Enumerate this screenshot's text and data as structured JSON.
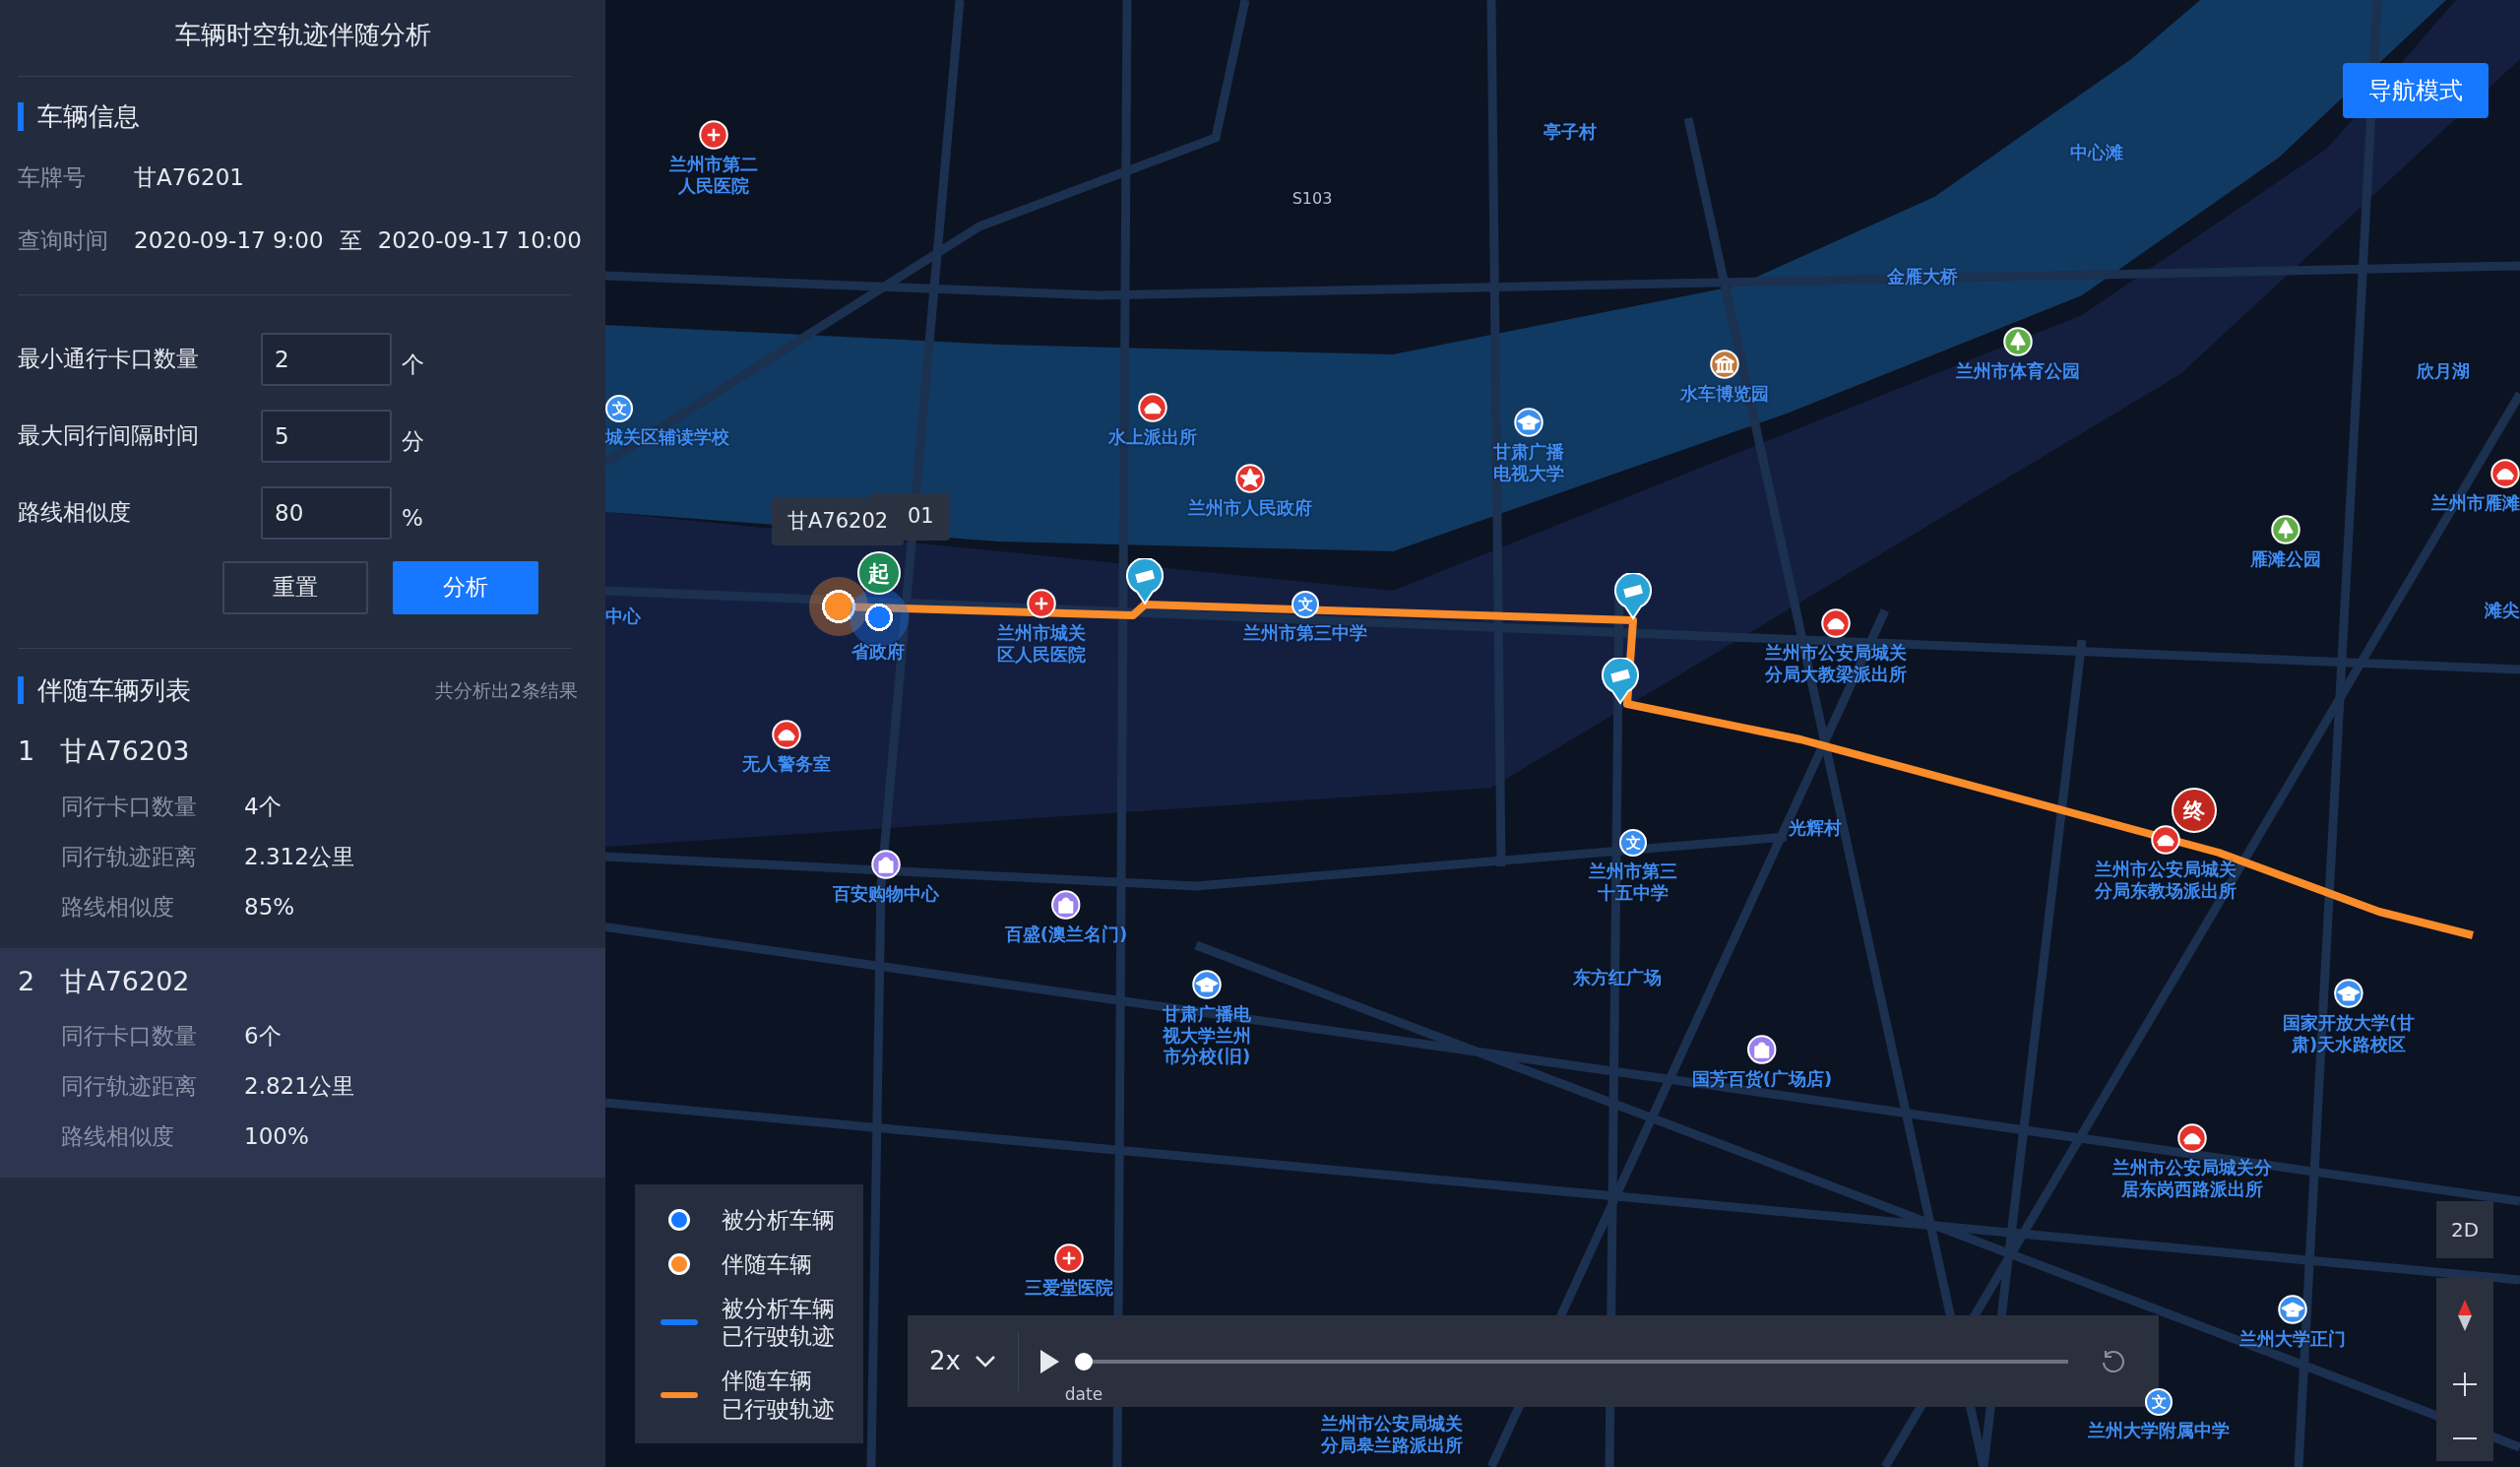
{
  "panel": {
    "title": "车辆时空轨迹伴随分析",
    "vehicle_info": {
      "heading": "车辆信息",
      "plate_label": "车牌号",
      "plate": "甘A76201",
      "time_label": "查询时间",
      "time_start": "2020-09-17 9:00",
      "time_sep": "至",
      "time_end": "2020-09-17 10:00"
    },
    "params": [
      {
        "label": "最小通行卡口数量",
        "value": "2",
        "unit": "个"
      },
      {
        "label": "最大同行间隔时间",
        "value": "5",
        "unit": "分"
      },
      {
        "label": "路线相似度",
        "value": "80",
        "unit": "%"
      }
    ],
    "buttons": [
      {
        "kind": "reset",
        "label": "重置"
      },
      {
        "kind": "primary",
        "label": "分析"
      }
    ],
    "results": {
      "heading": "伴随车辆列表",
      "summary": "共分析出2条结果",
      "items": [
        {
          "index": "1",
          "plate": "甘A76203",
          "selected": false,
          "stats": [
            {
              "label": "同行卡口数量",
              "value": "4个"
            },
            {
              "label": "同行轨迹距离",
              "value": "2.312公里"
            },
            {
              "label": "路线相似度",
              "value": "85%"
            }
          ]
        },
        {
          "index": "2",
          "plate": "甘A76202",
          "selected": true,
          "stats": [
            {
              "label": "同行卡口数量",
              "value": "6个"
            },
            {
              "label": "同行轨迹距离",
              "value": "2.821公里"
            },
            {
              "label": "路线相似度",
              "value": "100%"
            }
          ]
        }
      ]
    }
  },
  "map": {
    "nav_button": "导航模式",
    "view_button": "2D",
    "tooltips": [
      "甘A76202",
      "01"
    ],
    "start_marker": "起",
    "end_marker": "终",
    "pois": [
      {
        "kind": "hospital",
        "label": "兰州市第二人民医院"
      },
      {
        "kind": "place",
        "label": "亭子村"
      },
      {
        "kind": "road",
        "label": "S103"
      },
      {
        "kind": "place",
        "label": "中心滩"
      },
      {
        "kind": "place",
        "label": "金雁大桥"
      },
      {
        "kind": "museum",
        "label": "水车博览园"
      },
      {
        "kind": "park",
        "label": "兰州市体育公园"
      },
      {
        "kind": "place",
        "label": "欣月湖"
      },
      {
        "kind": "school",
        "label": "城关区辅读学校",
        "glyph": "文"
      },
      {
        "kind": "police",
        "label": "水上派出所"
      },
      {
        "kind": "college",
        "label": "甘肃广播电视大学"
      },
      {
        "kind": "government",
        "label": "兰州市人民政府"
      },
      {
        "kind": "police",
        "label": "兰州市雁滩"
      },
      {
        "kind": "park",
        "label": "雁滩公园"
      },
      {
        "kind": "place",
        "label": "中心"
      },
      {
        "kind": "hospital",
        "label": "兰州市城关区人民医院"
      },
      {
        "kind": "school",
        "label": "兰州市第三中学",
        "glyph": "文"
      },
      {
        "kind": "place",
        "label": "滩尖"
      },
      {
        "kind": "place",
        "label": "省政府"
      },
      {
        "kind": "police",
        "label": "兰州市公安局城关分局大教梁派出所"
      },
      {
        "kind": "police",
        "label": "无人警务室"
      },
      {
        "kind": "shop",
        "label": "百安购物中心"
      },
      {
        "kind": "school",
        "label": "兰州市第三十五中学",
        "glyph": "文"
      },
      {
        "kind": "place",
        "label": "光辉村"
      },
      {
        "kind": "police",
        "label": "兰州市公安局城关分局东教场派出所"
      },
      {
        "kind": "shop",
        "label": "百盛(澳兰名门)"
      },
      {
        "kind": "place",
        "label": "东方红广场"
      },
      {
        "kind": "college",
        "label": "甘肃广播电视大学兰州市分校(旧)"
      },
      {
        "kind": "shop",
        "label": "国芳百货(广场店)"
      },
      {
        "kind": "college",
        "label": "国家开放大学(甘肃)天水路校区"
      },
      {
        "kind": "police",
        "label": "兰州市公安局城关分居东岗西路派出所"
      },
      {
        "kind": "hospital",
        "label": "三爱堂医院"
      },
      {
        "kind": "college",
        "label": "兰州大学正门"
      },
      {
        "kind": "place",
        "label": "兰州市公安局城关分局皋兰路派出所"
      },
      {
        "kind": "school",
        "label": "兰州大学附属中学",
        "glyph": "文"
      }
    ],
    "legend": [
      {
        "kind": "dot",
        "color": "#1677ff",
        "label": "被分析车辆"
      },
      {
        "kind": "dot",
        "color": "#fa8c2a",
        "label": "伴随车辆"
      },
      {
        "kind": "line",
        "color": "#1677ff",
        "label": "被分析车辆已行驶轨迹"
      },
      {
        "kind": "line",
        "color": "#fa8c2a",
        "label": "伴随车辆已行驶轨迹"
      }
    ],
    "playback": {
      "speed": "2x",
      "time_label": "date",
      "level": 0
    }
  }
}
